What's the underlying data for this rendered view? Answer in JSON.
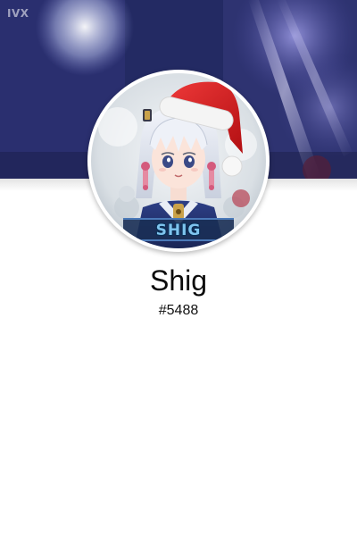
{
  "banner": {
    "watermark": "IVX"
  },
  "avatar": {
    "tag_text": "SHIG"
  },
  "profile": {
    "username": "Shig",
    "discriminator": "#5488"
  },
  "colors": {
    "banner_dark": "#1f2456",
    "avatar_ring": "#ffffff",
    "hat_red": "#d81f1f",
    "tag_blue": "#7ec4ee"
  }
}
